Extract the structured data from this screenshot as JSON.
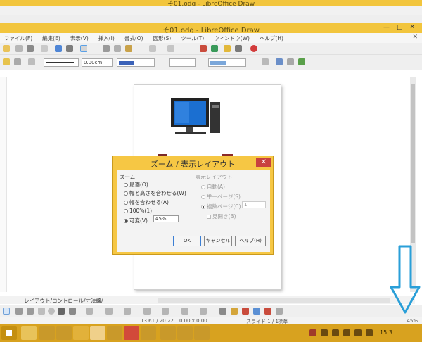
{
  "background_window": {
    "title": "そ01.odg - LibreOffice Draw"
  },
  "window": {
    "title": "そ01.odg - LibreOffice Draw",
    "controls": {
      "minimize": "—",
      "maximize": "□",
      "close": "✕"
    }
  },
  "menubar": {
    "items": [
      "ファイル(F)",
      "編集(E)",
      "表示(V)",
      "挿入(I)",
      "書式(O)",
      "図形(S)",
      "ツール(T)",
      "ウィンドウ(W)",
      "ヘルプ(H)"
    ],
    "close": "✕"
  },
  "toolbar2": {
    "line_width": "0.00cm",
    "line_color_label": "",
    "area_color_label": "",
    "shadow_label": ""
  },
  "tabs": {
    "current": "レイアウト/コントロール/寸法線/"
  },
  "statusbar": {
    "position": "13.61 / 20.22",
    "size": "0.00 x 0.00",
    "page": "スライド 1 / 1",
    "style": "標準",
    "zoom": "45%"
  },
  "taskbar": {
    "clock": "15:3"
  },
  "dialog": {
    "title": "ズーム / 表示レイアウト",
    "close": "✕",
    "zoom_group": {
      "title": "ズーム",
      "options": [
        "最適(O)",
        "幅と高さを合わせる(W)",
        "幅を合わせる(A)",
        "100%(1)"
      ],
      "variable_label": "可変(V)",
      "variable_value": "45%"
    },
    "layout_group": {
      "title": "表示レイアウト",
      "options": [
        "自動(A)",
        "単一ページ(S)",
        "複数ページ(C)"
      ],
      "columns_value": "1",
      "bookmode_label": "見開き(B)"
    },
    "buttons": {
      "ok": "OK",
      "cancel": "キャンセル",
      "help": "ヘルプ(H)"
    }
  },
  "colors": {
    "title_bar": "#f2c53d",
    "taskbar": "#d8a21f",
    "dialog_frame": "#f6c744",
    "close_button": "#c8413f",
    "annotation_arrow": "#2a9fd8"
  }
}
